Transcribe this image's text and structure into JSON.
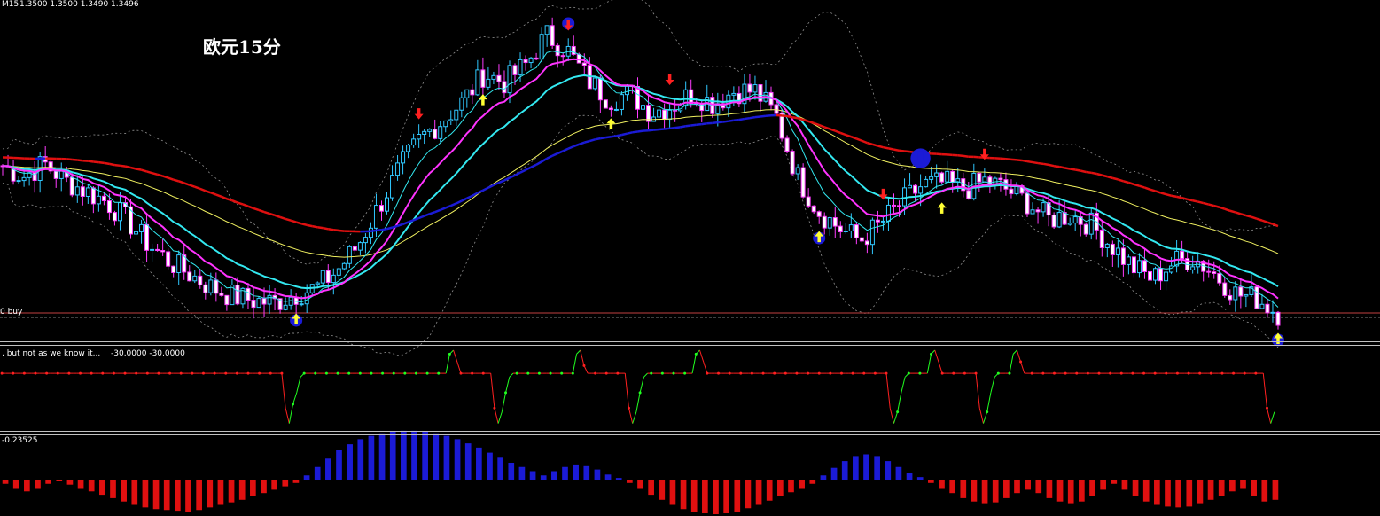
{
  "chart_data": [
    {
      "type": "candlestick",
      "header": {
        "timeframe": "M15",
        "ohlc": "1.3500 1.3500 1.3490 1.3496"
      },
      "title": "欧元15分",
      "order_line_label": "0 buy",
      "colors": {
        "bull": "#30c8ff",
        "bear": "#ff3cff",
        "fast_ma": "#ff33ff",
        "medium_ma": "#33e8f0",
        "slow_ma": "#f0f060",
        "trend_up": "#1b1bd6",
        "trend_down": "#e01010",
        "bollinger": "#909090",
        "arrow_buy": "#ffff33",
        "arrow_sell": "#ff2020",
        "arrow_outline": "#1b1bd6"
      },
      "price_path": [
        1.3565,
        1.356,
        1.3566,
        1.3558,
        1.3553,
        1.3548,
        1.3539,
        1.3528,
        1.352,
        1.3514,
        1.3508,
        1.3504,
        1.3502,
        1.3501,
        1.3505,
        1.3508,
        1.3516,
        1.3528,
        1.3546,
        1.3564,
        1.3578,
        1.3586,
        1.3595,
        1.3608,
        1.3604,
        1.3612,
        1.3626,
        1.3619,
        1.3605,
        1.3596,
        1.3599,
        1.359,
        1.3593,
        1.3599,
        1.3594,
        1.36,
        1.36,
        1.3588,
        1.356,
        1.3544,
        1.3536,
        1.353,
        1.3538,
        1.3548,
        1.3556,
        1.3557,
        1.3554,
        1.3558,
        1.3554,
        1.3548,
        1.354,
        1.3542,
        1.3538,
        1.3528,
        1.3518,
        1.3512,
        1.352,
        1.3522,
        1.3514,
        1.3505,
        1.3503,
        1.3496
      ],
      "arrows": [
        {
          "type": "buy",
          "index": 14,
          "outline": true
        },
        {
          "type": "buy",
          "index": 23,
          "outline": false
        },
        {
          "type": "sell",
          "index": 20,
          "outline": false
        },
        {
          "type": "sell",
          "index": 27,
          "outline": true
        },
        {
          "type": "sell",
          "index": 32,
          "outline": false
        },
        {
          "type": "buy",
          "index": 29,
          "outline": false
        },
        {
          "type": "buy",
          "index": 39,
          "outline": true
        },
        {
          "type": "sell",
          "index": 42,
          "outline": false
        },
        {
          "type": "sell",
          "index": 44,
          "outline": true,
          "large": true
        },
        {
          "type": "buy",
          "index": 45,
          "outline": false
        },
        {
          "type": "sell",
          "index": 47,
          "outline": false
        },
        {
          "type": "buy",
          "index": 61,
          "outline": true
        }
      ]
    },
    {
      "type": "line",
      "header": {
        "label": ", but not as we know it...",
        "values": "-30.0000 -30.0000"
      },
      "ylim": [
        -100,
        0
      ],
      "colors": {
        "down": "#ff2020",
        "up": "#20ff20"
      },
      "values": [
        -30,
        -30,
        -30,
        -30,
        -30,
        -30,
        -30,
        -30,
        -30,
        -30,
        -30,
        -30,
        -30,
        -30,
        -30,
        -30,
        -30,
        -30,
        -30,
        -30,
        -30,
        -30,
        -30,
        -30,
        -30,
        -30,
        -30,
        -30,
        -30,
        -30,
        -30,
        -30,
        -30,
        -30,
        -30,
        -30,
        -30,
        -30,
        -30,
        -30,
        -30,
        -30,
        -30,
        -30,
        -30,
        -30,
        -30,
        -30,
        -30,
        -30,
        -30,
        -30,
        -30,
        -30,
        -30,
        -30,
        -30,
        -30,
        -30,
        -30,
        -30,
        -30,
        -30,
        -30,
        -30,
        -30,
        -30,
        -30,
        -30,
        -30,
        -30,
        -30,
        -30,
        -30,
        -30,
        -30,
        -75,
        -95,
        -70,
        -55,
        -35,
        -30,
        -30,
        -30,
        -30,
        -30,
        -30,
        -30,
        -30,
        -30,
        -30,
        -30,
        -30,
        -30,
        -30,
        -30,
        -30,
        -30,
        -30,
        -30,
        -30,
        -30,
        -30,
        -30,
        -30,
        -30,
        -30,
        -30,
        -30,
        -30,
        -30,
        -30,
        -30,
        -30,
        -30,
        -30,
        -30,
        -30,
        -30,
        -30,
        -5,
        0,
        -15,
        -30,
        -30,
        -30,
        -30,
        -30,
        -30,
        -30,
        -30,
        -30,
        -75,
        -95,
        -80,
        -55,
        -35,
        -30,
        -30,
        -30,
        -30,
        -30,
        -30,
        -30,
        -30,
        -30,
        -30,
        -30,
        -30,
        -30,
        -30,
        -30,
        -30,
        -30,
        -5,
        0,
        -20,
        -30,
        -30,
        -30,
        -30,
        -30,
        -30,
        -30,
        -30,
        -30,
        -30,
        -30,
        -75,
        -95,
        -80,
        -55,
        -35,
        -30,
        -30,
        -30,
        -30,
        -30,
        -30,
        -30,
        -30,
        -30,
        -30,
        -30,
        -30,
        -30,
        -5,
        0,
        -15,
        -30,
        -30,
        -30,
        -30,
        -30,
        -30,
        -30,
        -30,
        -30,
        -30,
        -30,
        -30,
        -30,
        -30,
        -30,
        -30,
        -30,
        -30,
        -30,
        -30,
        -30,
        -30,
        -30,
        -30,
        -30,
        -30,
        -30,
        -30,
        -30,
        -30,
        -30,
        -30,
        -30,
        -30,
        -30,
        -30,
        -30,
        -30,
        -30,
        -30,
        -30,
        -30,
        -30,
        -30,
        -30,
        -30,
        -30,
        -30,
        -30,
        -75,
        -95,
        -80,
        -55,
        -35,
        -30,
        -30,
        -30,
        -30,
        -30,
        -30,
        -5,
        0,
        -15,
        -30,
        -30,
        -30,
        -30,
        -30,
        -30,
        -30,
        -30,
        -30,
        -30,
        -75,
        -95,
        -80,
        -55,
        -35,
        -30,
        -30,
        -30,
        -30,
        -5,
        0,
        -15,
        -30,
        -30,
        -30,
        -30,
        -30,
        -30,
        -30,
        -30,
        -30,
        -30,
        -30,
        -30,
        -30,
        -30,
        -30,
        -30,
        -30,
        -30,
        -30,
        -30,
        -30,
        -30,
        -30,
        -30,
        -30,
        -30,
        -30,
        -30,
        -30,
        -30,
        -30,
        -30,
        -30,
        -30,
        -30,
        -30,
        -30,
        -30,
        -30,
        -30,
        -30,
        -30,
        -30,
        -30,
        -30,
        -30,
        -30,
        -30,
        -30,
        -30,
        -30,
        -30,
        -30,
        -30,
        -30,
        -30,
        -30,
        -30,
        -30,
        -30,
        -30,
        -30,
        -30,
        -30,
        -30,
        -75,
        -95,
        -80
      ]
    },
    {
      "type": "bar",
      "header": {
        "value": "-0.23525"
      },
      "colors": {
        "positive": "#1b1bd6",
        "negative": "#e01010"
      },
      "values": [
        -0.05,
        -0.1,
        -0.14,
        -0.1,
        -0.05,
        -0.02,
        -0.06,
        -0.1,
        -0.14,
        -0.18,
        -0.22,
        -0.26,
        -0.3,
        -0.33,
        -0.35,
        -0.36,
        -0.37,
        -0.38,
        -0.36,
        -0.33,
        -0.3,
        -0.27,
        -0.24,
        -0.2,
        -0.16,
        -0.12,
        -0.08,
        -0.04,
        0.05,
        0.15,
        0.25,
        0.35,
        0.42,
        0.48,
        0.52,
        0.55,
        0.57,
        0.58,
        0.58,
        0.57,
        0.55,
        0.52,
        0.48,
        0.43,
        0.38,
        0.32,
        0.26,
        0.2,
        0.15,
        0.1,
        0.05,
        0.1,
        0.15,
        0.18,
        0.16,
        0.12,
        0.06,
        0.02,
        -0.04,
        -0.1,
        -0.18,
        -0.24,
        -0.3,
        -0.35,
        -0.38,
        -0.4,
        -0.41,
        -0.4,
        -0.38,
        -0.34,
        -0.3,
        -0.25,
        -0.2,
        -0.15,
        -0.1,
        -0.05,
        0.05,
        0.14,
        0.22,
        0.28,
        0.3,
        0.28,
        0.22,
        0.15,
        0.08,
        0.03,
        -0.04,
        -0.1,
        -0.16,
        -0.22,
        -0.26,
        -0.28,
        -0.27,
        -0.22,
        -0.16,
        -0.12,
        -0.16,
        -0.22,
        -0.26,
        -0.28,
        -0.26,
        -0.2,
        -0.12,
        -0.05,
        -0.12,
        -0.2,
        -0.26,
        -0.3,
        -0.32,
        -0.33,
        -0.32,
        -0.28,
        -0.24,
        -0.2,
        -0.14,
        -0.1,
        -0.2,
        -0.26,
        -0.24
      ]
    }
  ]
}
